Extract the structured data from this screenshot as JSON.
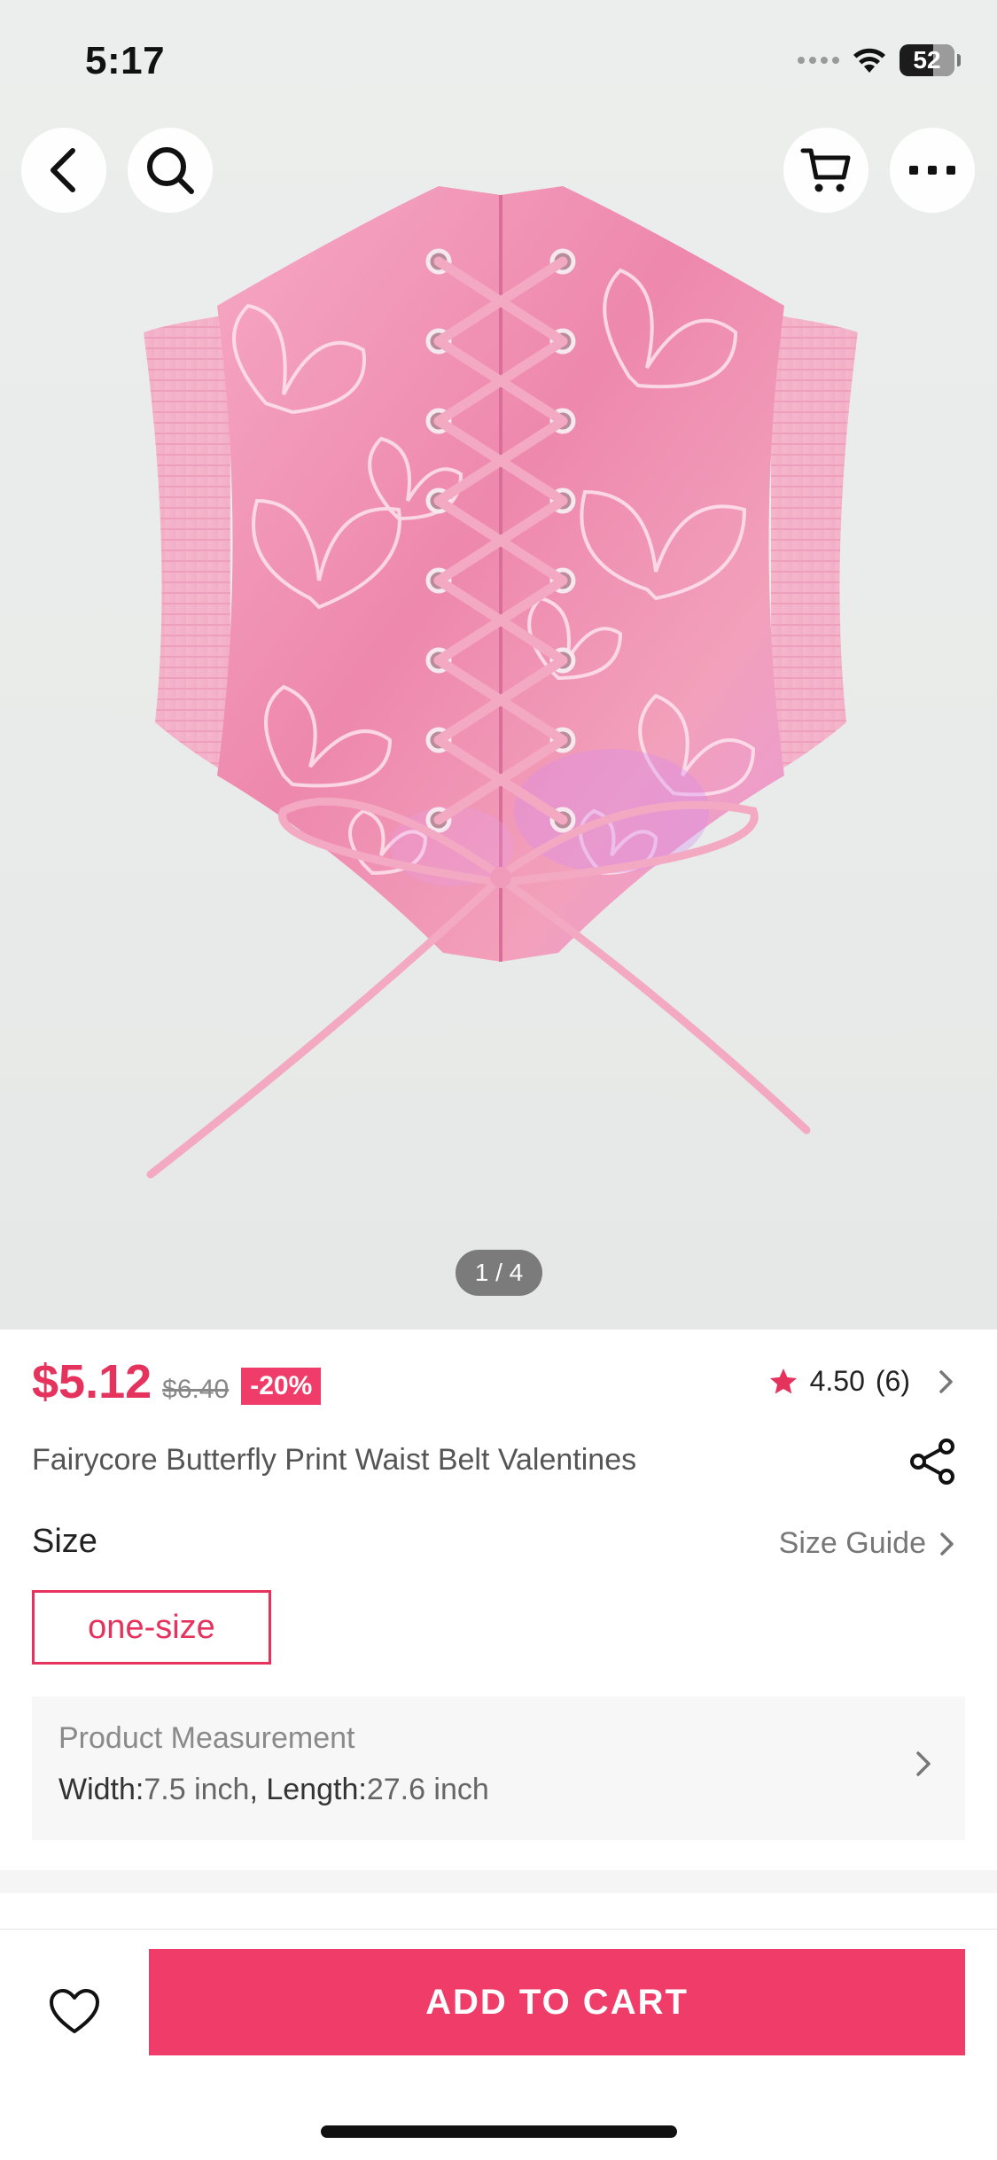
{
  "status_bar": {
    "time": "5:17",
    "battery": "52"
  },
  "header": {
    "icons": [
      "back-arrow-icon",
      "search-icon",
      "cart-icon",
      "more-icon"
    ]
  },
  "gallery": {
    "counter": "1 / 4"
  },
  "product": {
    "price": "$5.12",
    "original_price": "$6.40",
    "discount": "-20%",
    "rating": "4.50",
    "review_count": "(6)",
    "title": "Fairycore Butterfly Print Waist Belt Valentines"
  },
  "size": {
    "label": "Size",
    "guide_label": "Size Guide",
    "options": [
      "one-size"
    ],
    "selected": "one-size"
  },
  "measurement": {
    "title": "Product Measurement",
    "width_label": "Width:",
    "width_value": "7.5 inch",
    "separator": ", ",
    "length_label": "Length:",
    "length_value": "27.6 inch"
  },
  "bottom_bar": {
    "add_to_cart": "ADD TO CART"
  },
  "colors": {
    "accent": "#ef3c68",
    "price": "#e6335d",
    "product_pink": "#f29ab8"
  }
}
